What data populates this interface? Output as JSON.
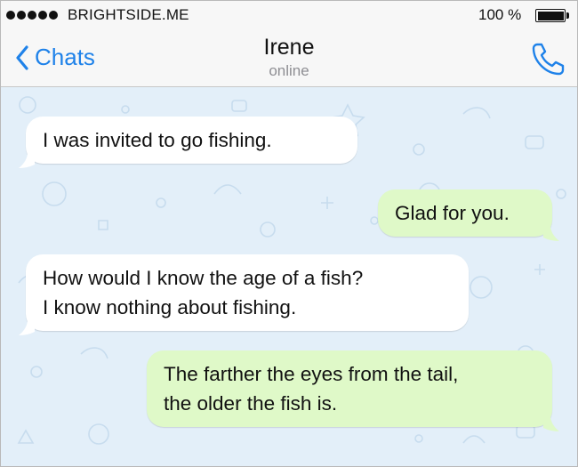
{
  "status_bar": {
    "carrier": "BRIGHTSIDE.ME",
    "battery": "100 %",
    "signal_bars": 5
  },
  "header": {
    "back_label": "Chats",
    "contact_name": "Irene",
    "contact_status": "online"
  },
  "messages": [
    {
      "direction": "incoming",
      "lines": [
        "I was invited to go fishing."
      ]
    },
    {
      "direction": "outgoing",
      "lines": [
        "Glad for you."
      ]
    },
    {
      "direction": "incoming",
      "lines": [
        "How would I know the age of a fish?",
        "I know nothing about fishing."
      ]
    },
    {
      "direction": "outgoing",
      "lines": [
        "The farther the eyes from the tail,",
        "the older the fish is."
      ]
    }
  ],
  "colors": {
    "accent": "#1f82e9",
    "chat_background": "#e3eff9",
    "incoming_bubble": "#ffffff",
    "outgoing_bubble": "#dff9c8"
  },
  "icons": {
    "back": "chevron-left-icon",
    "call": "phone-icon",
    "battery": "battery-icon",
    "signal": "signal-dots-icon"
  }
}
